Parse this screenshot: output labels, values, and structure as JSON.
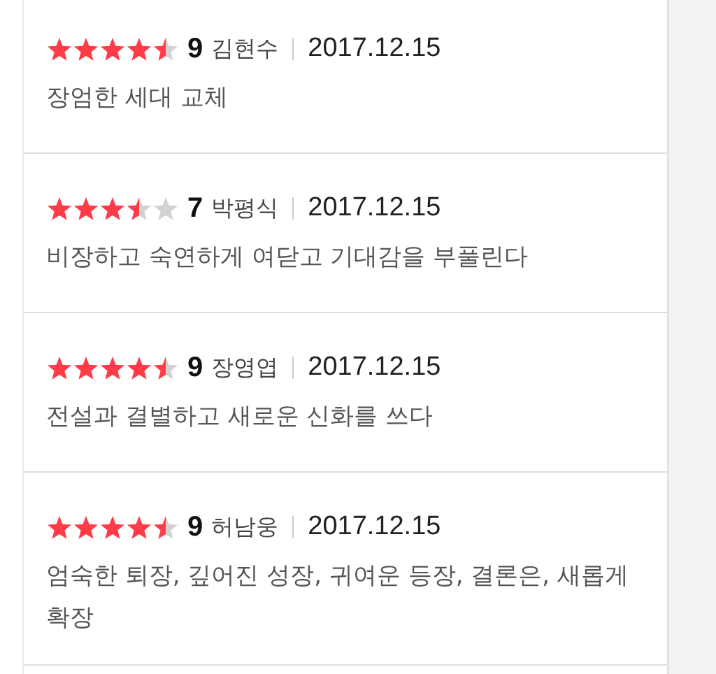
{
  "reviews": [
    {
      "stars": 4.5,
      "score": "9",
      "author": "김현수",
      "date": "2017.12.15",
      "comment": "장엄한 세대 교체"
    },
    {
      "stars": 3.5,
      "score": "7",
      "author": "박평식",
      "date": "2017.12.15",
      "comment": "비장하고 숙연하게 여닫고 기대감을 부풀린다"
    },
    {
      "stars": 4.5,
      "score": "9",
      "author": "장영엽",
      "date": "2017.12.15",
      "comment": "전설과 결별하고 새로운 신화를 쓰다"
    },
    {
      "stars": 4.5,
      "score": "9",
      "author": "허남웅",
      "date": "2017.12.15",
      "comment": "엄숙한 퇴장, 깊어진 성장, 귀여운 등장, 결론은, 새롭게 확장"
    }
  ]
}
